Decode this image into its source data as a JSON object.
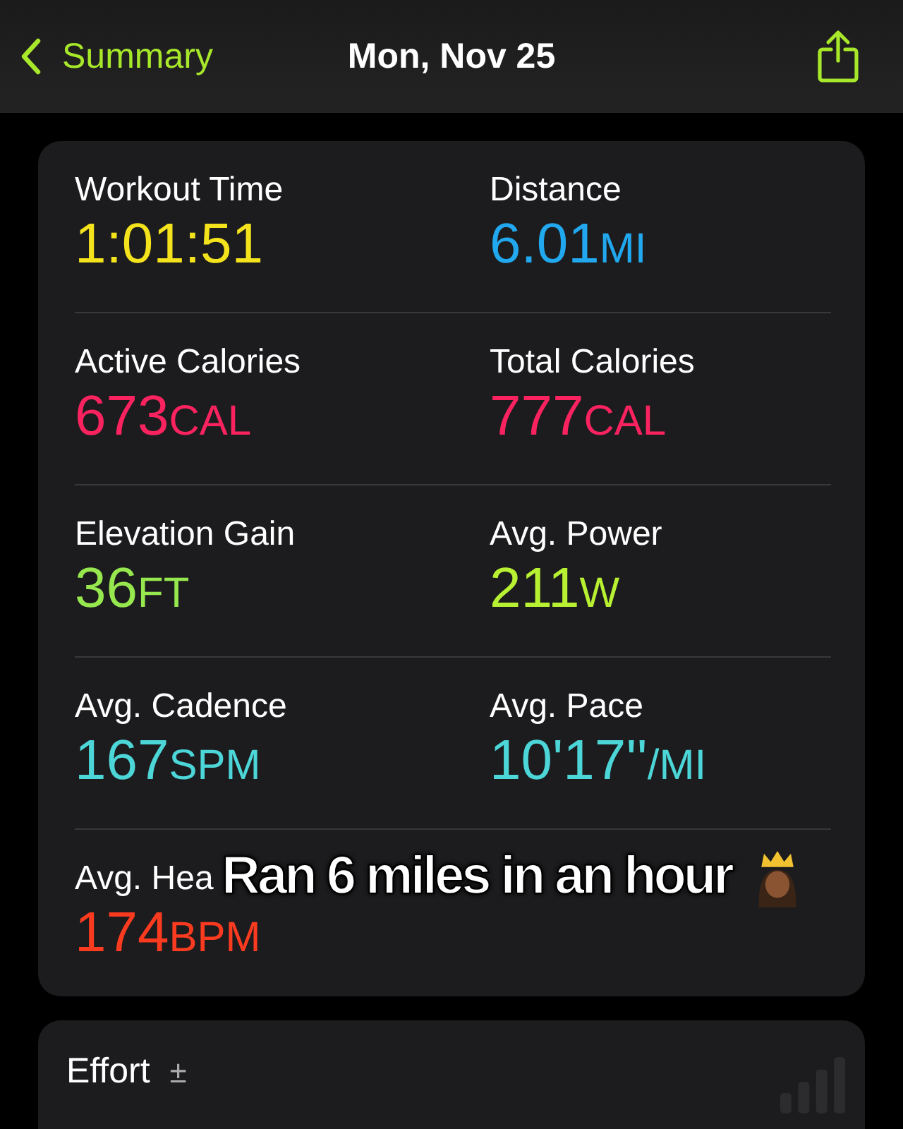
{
  "nav": {
    "back_label": "Summary",
    "title": "Mon, Nov 25"
  },
  "metrics": [
    {
      "label": "Workout Time",
      "value": "1:01:51",
      "color": "#f4e31c"
    },
    {
      "label": "Distance",
      "value": "6.01",
      "unit": "MI",
      "color": "#22a8ee"
    },
    {
      "label": "Active Calories",
      "value": "673",
      "unit": "CAL",
      "color": "#fa2360"
    },
    {
      "label": "Total Calories",
      "value": "777",
      "unit": "CAL",
      "color": "#fa2360"
    },
    {
      "label": "Elevation Gain",
      "value": "36",
      "unit": "FT",
      "color": "#96e84e"
    },
    {
      "label": "Avg. Power",
      "value": "211",
      "unit": "W",
      "color": "#b8f032"
    },
    {
      "label": "Avg. Cadence",
      "value": "167",
      "unit": "SPM",
      "color": "#4cd6d8"
    },
    {
      "label": "Avg. Pace",
      "value": "10'17''",
      "unit": "/MI",
      "color": "#4cd6d8"
    },
    {
      "label": "Avg. Hea",
      "value": "174",
      "unit": "BPM",
      "color": "#fb3b1f"
    }
  ],
  "caption": "Ran 6 miles in an hour",
  "effort": {
    "title": "Effort",
    "mark": "±"
  }
}
